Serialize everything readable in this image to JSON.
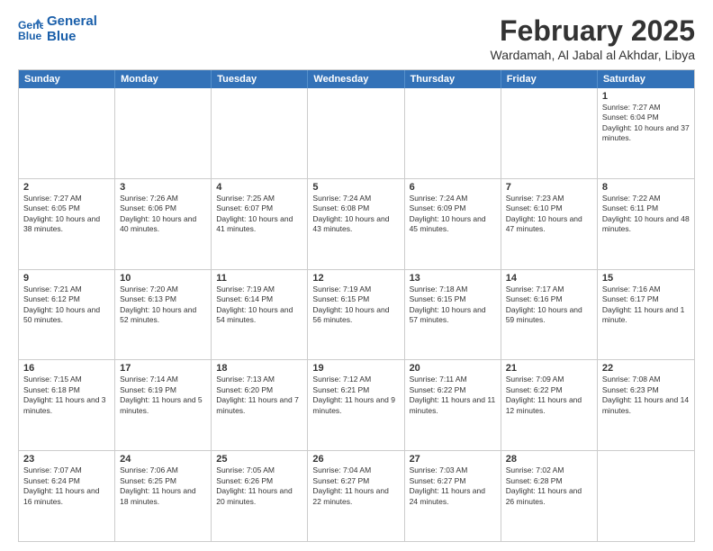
{
  "header": {
    "logo_line1": "General",
    "logo_line2": "Blue",
    "title": "February 2025",
    "subtitle": "Wardamah, Al Jabal al Akhdar, Libya"
  },
  "days_of_week": [
    "Sunday",
    "Monday",
    "Tuesday",
    "Wednesday",
    "Thursday",
    "Friday",
    "Saturday"
  ],
  "weeks": [
    [
      {
        "day": "",
        "text": ""
      },
      {
        "day": "",
        "text": ""
      },
      {
        "day": "",
        "text": ""
      },
      {
        "day": "",
        "text": ""
      },
      {
        "day": "",
        "text": ""
      },
      {
        "day": "",
        "text": ""
      },
      {
        "day": "1",
        "text": "Sunrise: 7:27 AM\nSunset: 6:04 PM\nDaylight: 10 hours and 37 minutes."
      }
    ],
    [
      {
        "day": "2",
        "text": "Sunrise: 7:27 AM\nSunset: 6:05 PM\nDaylight: 10 hours and 38 minutes."
      },
      {
        "day": "3",
        "text": "Sunrise: 7:26 AM\nSunset: 6:06 PM\nDaylight: 10 hours and 40 minutes."
      },
      {
        "day": "4",
        "text": "Sunrise: 7:25 AM\nSunset: 6:07 PM\nDaylight: 10 hours and 41 minutes."
      },
      {
        "day": "5",
        "text": "Sunrise: 7:24 AM\nSunset: 6:08 PM\nDaylight: 10 hours and 43 minutes."
      },
      {
        "day": "6",
        "text": "Sunrise: 7:24 AM\nSunset: 6:09 PM\nDaylight: 10 hours and 45 minutes."
      },
      {
        "day": "7",
        "text": "Sunrise: 7:23 AM\nSunset: 6:10 PM\nDaylight: 10 hours and 47 minutes."
      },
      {
        "day": "8",
        "text": "Sunrise: 7:22 AM\nSunset: 6:11 PM\nDaylight: 10 hours and 48 minutes."
      }
    ],
    [
      {
        "day": "9",
        "text": "Sunrise: 7:21 AM\nSunset: 6:12 PM\nDaylight: 10 hours and 50 minutes."
      },
      {
        "day": "10",
        "text": "Sunrise: 7:20 AM\nSunset: 6:13 PM\nDaylight: 10 hours and 52 minutes."
      },
      {
        "day": "11",
        "text": "Sunrise: 7:19 AM\nSunset: 6:14 PM\nDaylight: 10 hours and 54 minutes."
      },
      {
        "day": "12",
        "text": "Sunrise: 7:19 AM\nSunset: 6:15 PM\nDaylight: 10 hours and 56 minutes."
      },
      {
        "day": "13",
        "text": "Sunrise: 7:18 AM\nSunset: 6:15 PM\nDaylight: 10 hours and 57 minutes."
      },
      {
        "day": "14",
        "text": "Sunrise: 7:17 AM\nSunset: 6:16 PM\nDaylight: 10 hours and 59 minutes."
      },
      {
        "day": "15",
        "text": "Sunrise: 7:16 AM\nSunset: 6:17 PM\nDaylight: 11 hours and 1 minute."
      }
    ],
    [
      {
        "day": "16",
        "text": "Sunrise: 7:15 AM\nSunset: 6:18 PM\nDaylight: 11 hours and 3 minutes."
      },
      {
        "day": "17",
        "text": "Sunrise: 7:14 AM\nSunset: 6:19 PM\nDaylight: 11 hours and 5 minutes."
      },
      {
        "day": "18",
        "text": "Sunrise: 7:13 AM\nSunset: 6:20 PM\nDaylight: 11 hours and 7 minutes."
      },
      {
        "day": "19",
        "text": "Sunrise: 7:12 AM\nSunset: 6:21 PM\nDaylight: 11 hours and 9 minutes."
      },
      {
        "day": "20",
        "text": "Sunrise: 7:11 AM\nSunset: 6:22 PM\nDaylight: 11 hours and 11 minutes."
      },
      {
        "day": "21",
        "text": "Sunrise: 7:09 AM\nSunset: 6:22 PM\nDaylight: 11 hours and 12 minutes."
      },
      {
        "day": "22",
        "text": "Sunrise: 7:08 AM\nSunset: 6:23 PM\nDaylight: 11 hours and 14 minutes."
      }
    ],
    [
      {
        "day": "23",
        "text": "Sunrise: 7:07 AM\nSunset: 6:24 PM\nDaylight: 11 hours and 16 minutes."
      },
      {
        "day": "24",
        "text": "Sunrise: 7:06 AM\nSunset: 6:25 PM\nDaylight: 11 hours and 18 minutes."
      },
      {
        "day": "25",
        "text": "Sunrise: 7:05 AM\nSunset: 6:26 PM\nDaylight: 11 hours and 20 minutes."
      },
      {
        "day": "26",
        "text": "Sunrise: 7:04 AM\nSunset: 6:27 PM\nDaylight: 11 hours and 22 minutes."
      },
      {
        "day": "27",
        "text": "Sunrise: 7:03 AM\nSunset: 6:27 PM\nDaylight: 11 hours and 24 minutes."
      },
      {
        "day": "28",
        "text": "Sunrise: 7:02 AM\nSunset: 6:28 PM\nDaylight: 11 hours and 26 minutes."
      },
      {
        "day": "",
        "text": ""
      }
    ]
  ]
}
